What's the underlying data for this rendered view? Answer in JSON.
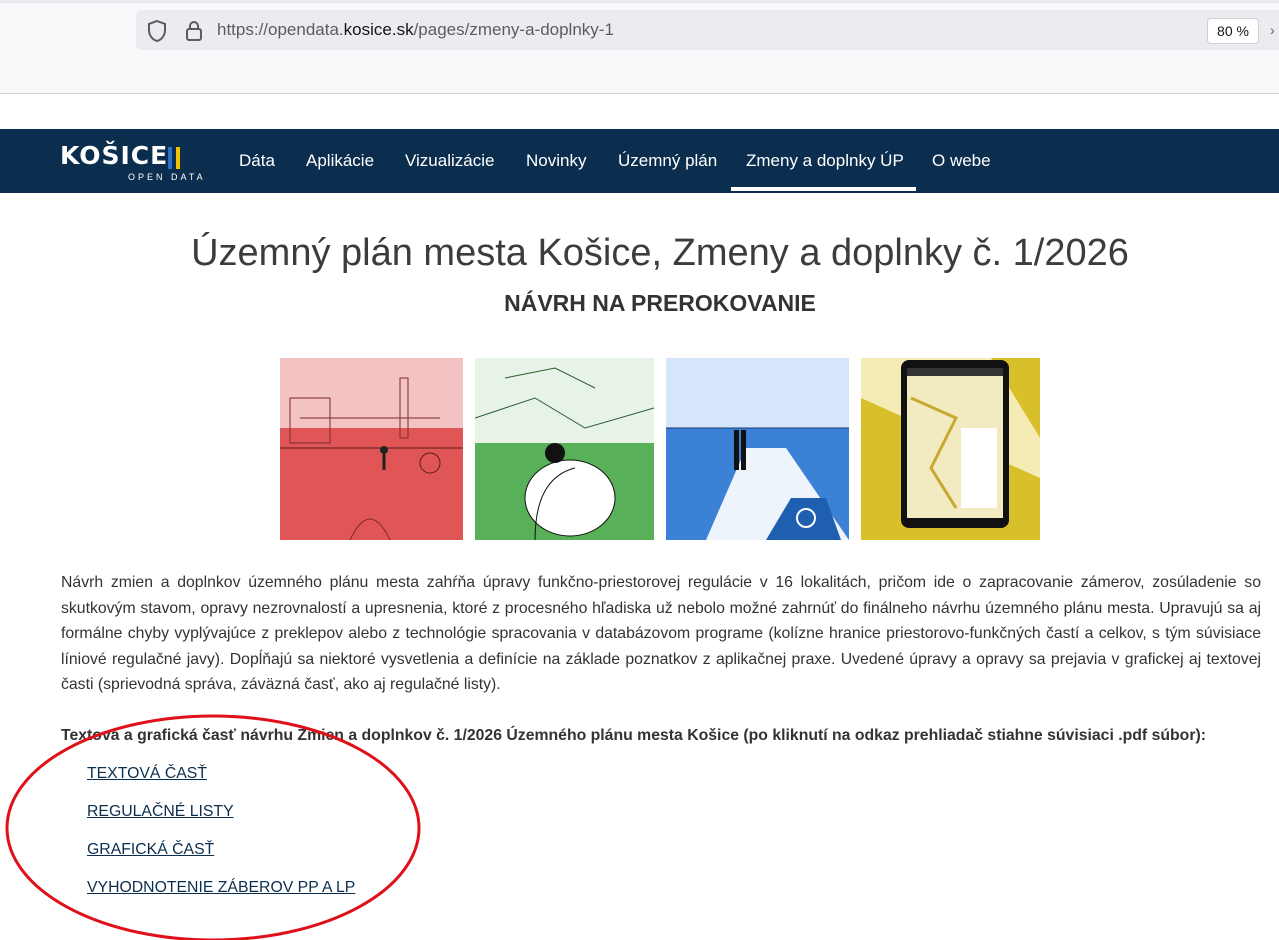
{
  "browser": {
    "url_prefix": "https://opendata.",
    "url_host": "kosice.sk",
    "url_path": "/pages/zmeny-a-doplnky-1",
    "zoom": "80 %"
  },
  "logo": {
    "main": "KOŠICE",
    "sub": "OPEN DATA"
  },
  "nav": {
    "items": [
      "Dáta",
      "Aplikácie",
      "Vizualizácie",
      "Novinky",
      "Územný plán",
      "Zmeny a doplnky ÚP",
      "O webe"
    ],
    "active": "Zmeny a doplnky ÚP"
  },
  "page": {
    "title": "Územný plán mesta Košice, Zmeny a doplnky č. 1/2026",
    "subtitle": "NÁVRH NA PREROKOVANIE",
    "paragraph": "Návrh zmien a doplnkov územného plánu mesta zahŕňa úpravy funkčno-priestorovej regulácie v 16 lokalitách, pričom ide o zapracovanie zámerov, zosúladenie so skutkovým stavom, opravy nezrovnalostí a upresnenia, ktoré z procesného hľadiska už nebolo možné zahrnúť do finálneho návrhu územného plánu mesta. Upravujú sa aj formálne chyby vyplývajúce z preklepov alebo z technológie spracovania v databázovom programe (kolízne hranice priestorovo-funkčných častí a celkov, s tým súvisiace líniové regulačné javy). Dopĺňajú sa niektoré vysvetlenia a definície na základe poznatkov z aplikačnej praxe. Uvedené úpravy a opravy sa prejavia v grafickej aj textovej časti (sprievodná správa, záväzná časť, ako aj regulačné listy).",
    "docs_heading": "Textová a grafická časť návrhu Zmien a doplnkov č. 1/2026 Územného plánu mesta Košice (po kliknutí na odkaz prehliadač stiahne súvisiaci .pdf súbor):",
    "links": [
      "TEXTOVÁ ČASŤ",
      "REGULAČNÉ LISTY",
      "GRAFICKÁ ČASŤ",
      "VYHODNOTENIE ZÁBEROV PP A LP"
    ]
  },
  "colors": {
    "navbar": "#0c2e4e",
    "annotation_circle": "#e0101a",
    "image_red": "#e85a5a",
    "image_green": "#6cbf6c",
    "image_blue": "#3d86d8",
    "image_yellow": "#d8c02a"
  }
}
